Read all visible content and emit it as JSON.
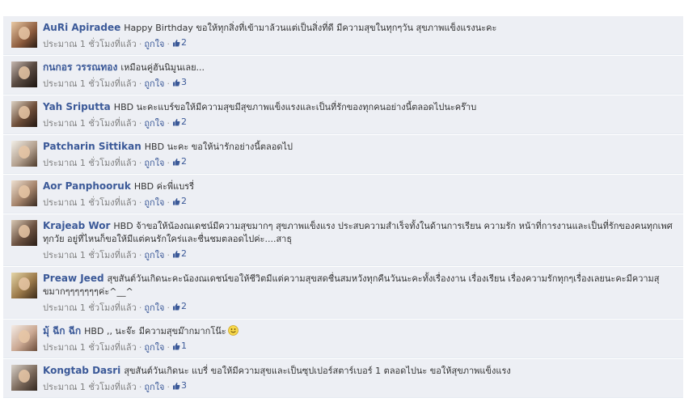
{
  "time_label": "ประมาณ 1 ชั่วโมงที่แล้ว",
  "like_label": "ถูกใจ",
  "separator": "·",
  "colors": {
    "link": "#3b5998",
    "background": "#edeff4",
    "meta": "#808080"
  },
  "comments": [
    {
      "author": "AuRi Apiradee",
      "text": "Happy Birthday ขอให้ทุกสิ่งที่เข้ามาล้วนแต่เป็นสิ่งที่ดี มีความสุขในทุกๆวัน สุขภาพแข็งแรงนะคะ",
      "likes": "2"
    },
    {
      "author": "กนกอร วรรณทอง",
      "text": "เหมือนคู่ฮันนิมูนเลย...",
      "likes": "3"
    },
    {
      "author": "Yah Sriputta",
      "text": "HBD นะคะแบร์ขอให้มีความสุขมีสุขภาพแข็งแรงและเป็นที่รักของทุกคนอย่างนี้ตลอดไปนะคร๊าบ",
      "likes": "2"
    },
    {
      "author": "Patcharin Sittikan",
      "text": "HBD นะคะ ขอให้น่ารักอย่างนี้ตลอดไป",
      "likes": "2"
    },
    {
      "author": "Aor Panphooruk",
      "text": "HBD ค่ะพี่แบรรี่",
      "likes": "2"
    },
    {
      "author": "Krajeab Wor",
      "text": "HBD จ้าขอให้น้องณเดชน์มีความสุขมากๆ สุขภาพแข็งแรง ประสบความสำเร็จทั้งในด้านการเรียน ความรัก หน้าที่การงานและเป็นที่รักของคนทุกเพศ ทุกวัย อยู่ที่ไหนก็ขอให้มีแต่คนรักใคร่และชื่นชมตลอดไปค่ะ....สาธุ",
      "likes": "2"
    },
    {
      "author": "Preaw Jeed",
      "text": "สุขสันต์วันเกิดนะคะน้องณเดชน์ขอให้ชีวิตมีแต่ความสุขสดชื่นสมหวังทุกคืนวันนะคะทั้งเรื่องงาน เรื่องเรียน เรื่องความรักทุกๆเรื่องเลยนะคะมีความสุขมากๆๆๆๆๆๆๆค่ะ^__^",
      "likes": "2"
    },
    {
      "author": "มุ้ ฉีก ฉีก",
      "text": "HBD ,, นะจ๊ะ มีความสุขม๊ากมากโน๊ะ",
      "smiley": "smiley-emoticon",
      "likes": "1"
    },
    {
      "author": "Kongtab Dasri",
      "text": "สุขสันต์วันเกิดนะ แบรี่ ขอให้มีความสุขและเป็นซุปเปอร์สตาร์เบอร์ 1 ตลอดไปนะ ขอให้สุขภาพแข็งแรง",
      "likes": "3"
    }
  ]
}
